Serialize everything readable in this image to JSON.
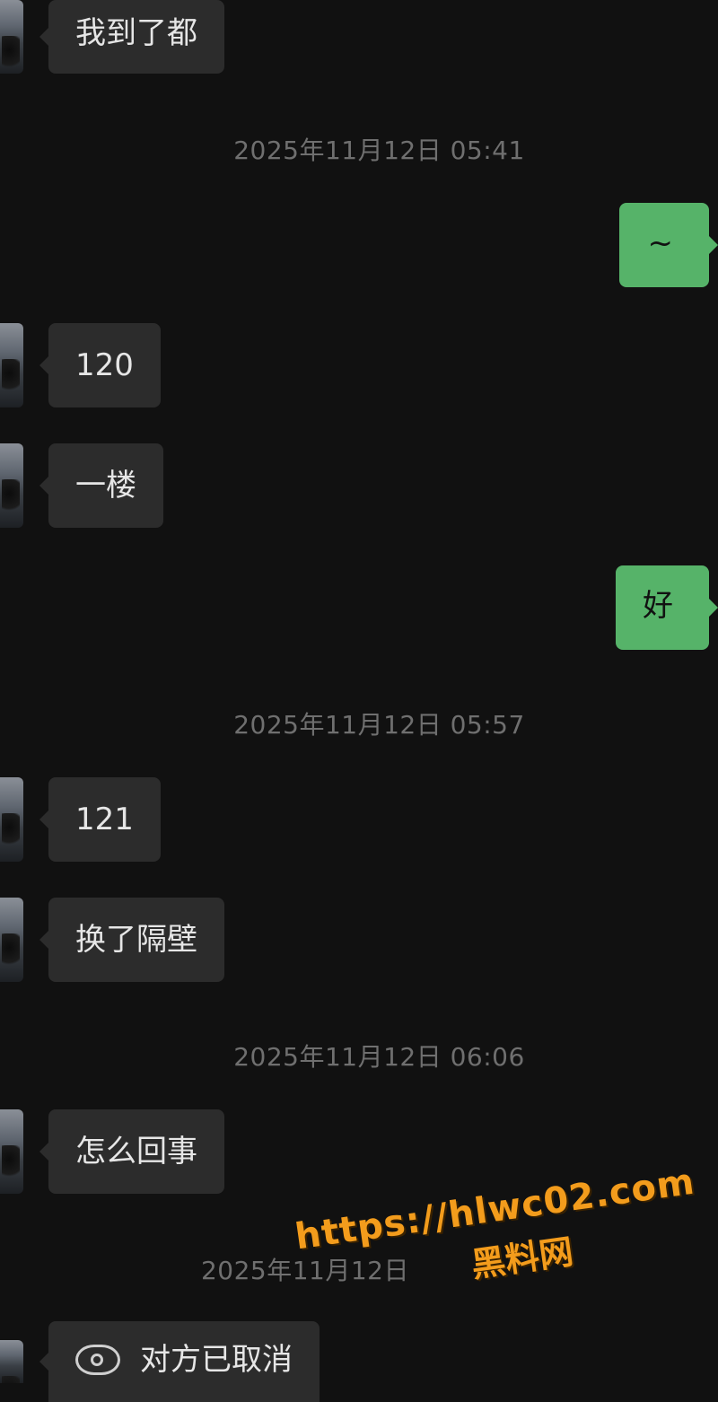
{
  "colors": {
    "background": "#111111",
    "incoming_bubble": "#2c2c2c",
    "outgoing_bubble": "#56b369",
    "timestamp": "#6f6f6f",
    "watermark": "#f39c1c"
  },
  "messages": [
    {
      "type": "incoming",
      "text": "我到了都"
    },
    {
      "type": "timestamp",
      "text": "2025年11月12日 05:41"
    },
    {
      "type": "outgoing",
      "text": "~"
    },
    {
      "type": "incoming",
      "text": "120"
    },
    {
      "type": "incoming",
      "text": "一楼"
    },
    {
      "type": "outgoing",
      "text": "好"
    },
    {
      "type": "timestamp",
      "text": "2025年11月12日 05:57"
    },
    {
      "type": "incoming",
      "text": "121"
    },
    {
      "type": "incoming",
      "text": "换了隔壁"
    },
    {
      "type": "timestamp",
      "text": "2025年11月12日 06:06"
    },
    {
      "type": "incoming",
      "text": "怎么回事"
    },
    {
      "type": "timestamp",
      "text": "2025年11月12日"
    },
    {
      "type": "incoming",
      "icon": "phone-cancel-icon",
      "text": "对方已取消"
    }
  ],
  "watermark": {
    "url": "https://hlwc02.com",
    "name": "黑料网"
  }
}
